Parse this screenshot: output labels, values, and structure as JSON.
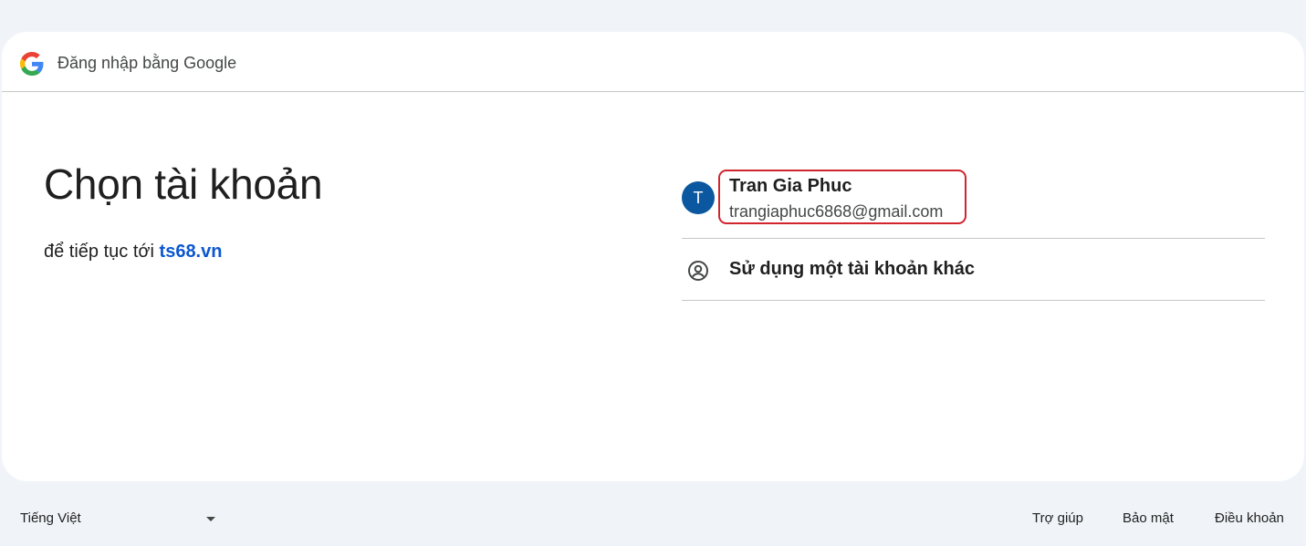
{
  "header": {
    "title": "Đăng nhập bằng Google",
    "logo_icon": "google-g-icon"
  },
  "main": {
    "heading": "Chọn tài khoản",
    "subtitle_prefix": "để tiếp tục tới",
    "site": "ts68.vn"
  },
  "accounts": [
    {
      "avatar_letter": "T",
      "name": "Tran Gia Phuc",
      "email": "trangiaphuc6868@gmail.com",
      "avatar_color": "#0b57a0"
    }
  ],
  "other_account": {
    "label": "Sử dụng một tài khoản khác",
    "icon": "account-circle-icon"
  },
  "footer": {
    "language": "Tiếng Việt",
    "links": [
      "Trợ giúp",
      "Bảo mật",
      "Điều khoản"
    ]
  },
  "colors": {
    "background": "#f0f4f9",
    "link": "#0b57d0",
    "highlight": "#d0252f"
  }
}
